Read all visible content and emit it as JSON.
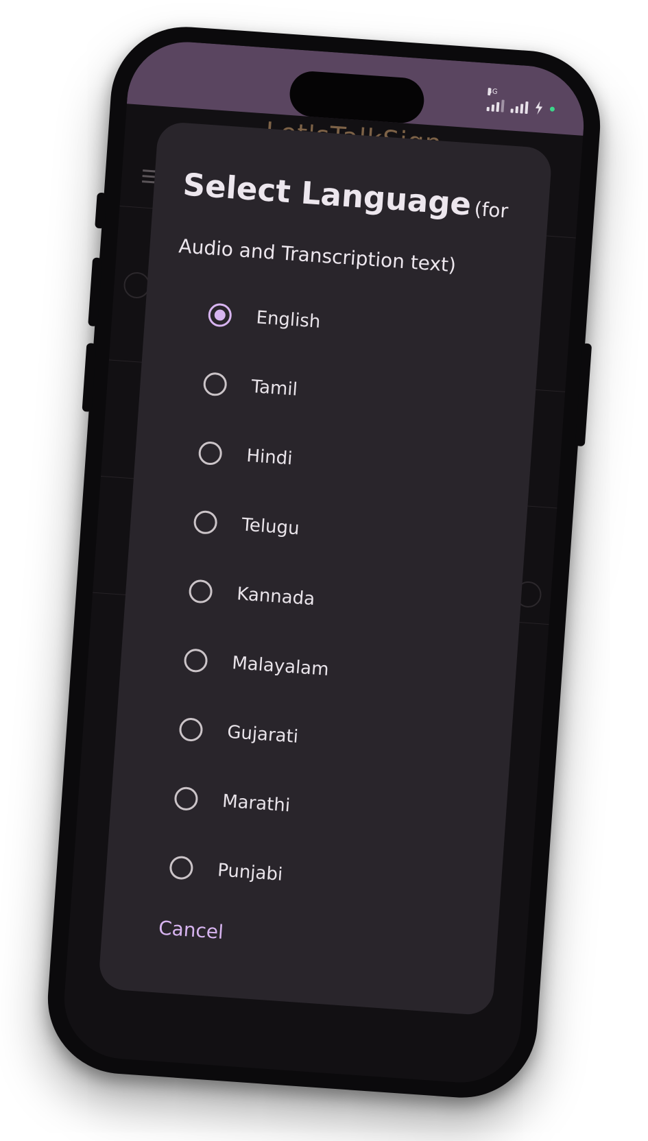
{
  "app": {
    "title": "Let'sTalkSign"
  },
  "status_bar": {
    "network": "4G",
    "colors": {
      "bar": "#5a4560",
      "indicator": "#3cd68a"
    }
  },
  "dialog": {
    "title": "Select Language",
    "subtitle": "(for Audio and Transcription text)",
    "options": [
      {
        "label": "English",
        "selected": true
      },
      {
        "label": "Tamil",
        "selected": false
      },
      {
        "label": "Hindi",
        "selected": false
      },
      {
        "label": "Telugu",
        "selected": false
      },
      {
        "label": "Kannada",
        "selected": false
      },
      {
        "label": "Malayalam",
        "selected": false
      },
      {
        "label": "Gujarati",
        "selected": false
      },
      {
        "label": "Marathi",
        "selected": false
      },
      {
        "label": "Punjabi",
        "selected": false
      }
    ],
    "cancel_label": "Cancel",
    "colors": {
      "accent": "#d7b4f0",
      "surface": "#29252b"
    }
  }
}
